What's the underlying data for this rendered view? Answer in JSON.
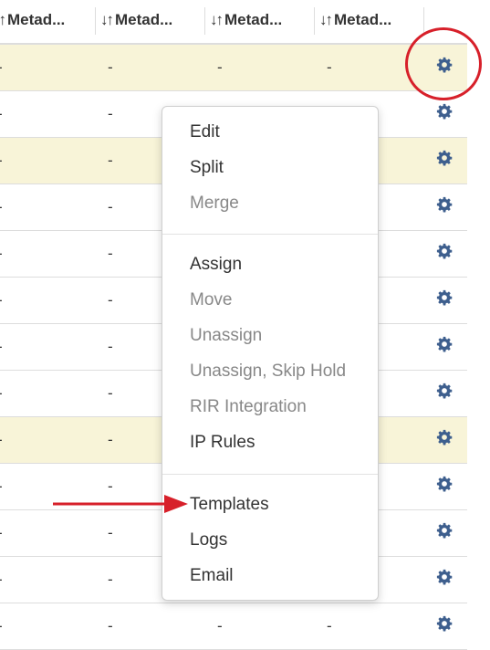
{
  "table": {
    "columns": [
      {
        "sort_icon": "↓↑",
        "label": "Metad..."
      },
      {
        "sort_icon": "↓↑",
        "label": "Metad..."
      },
      {
        "sort_icon": "↓↑",
        "label": "Metad..."
      },
      {
        "sort_icon": "↓↑",
        "label": "Metad..."
      }
    ],
    "rows": [
      {
        "highlight": true,
        "cells": [
          "-",
          "-",
          "-",
          "-"
        ],
        "action_icon": "gear-icon"
      },
      {
        "highlight": false,
        "cells": [
          "-",
          "-",
          "",
          ""
        ],
        "action_icon": "gear-icon"
      },
      {
        "highlight": true,
        "cells": [
          "-",
          "-",
          "",
          ""
        ],
        "action_icon": "gear-icon"
      },
      {
        "highlight": false,
        "cells": [
          "-",
          "-",
          "",
          ""
        ],
        "action_icon": "gear-icon"
      },
      {
        "highlight": false,
        "cells": [
          "-",
          "-",
          "",
          ""
        ],
        "action_icon": "gear-icon"
      },
      {
        "highlight": false,
        "cells": [
          "-",
          "-",
          "",
          ""
        ],
        "action_icon": "gear-icon"
      },
      {
        "highlight": false,
        "cells": [
          "-",
          "-",
          "",
          ""
        ],
        "action_icon": "gear-icon"
      },
      {
        "highlight": false,
        "cells": [
          "-",
          "-",
          "",
          ""
        ],
        "action_icon": "gear-icon"
      },
      {
        "highlight": true,
        "cells": [
          "-",
          "-",
          "",
          ""
        ],
        "action_icon": "gear-icon"
      },
      {
        "highlight": false,
        "cells": [
          "-",
          "-",
          "",
          ""
        ],
        "action_icon": "gear-icon"
      },
      {
        "highlight": false,
        "cells": [
          "-",
          "-",
          "",
          ""
        ],
        "action_icon": "gear-icon"
      },
      {
        "highlight": false,
        "cells": [
          "-",
          "-",
          "",
          ""
        ],
        "action_icon": "gear-icon"
      },
      {
        "highlight": false,
        "cells": [
          "-",
          "-",
          "-",
          "-"
        ],
        "action_icon": "gear-icon"
      }
    ]
  },
  "context_menu": {
    "groups": [
      [
        {
          "label": "Edit",
          "enabled": true
        },
        {
          "label": "Split",
          "enabled": true
        },
        {
          "label": "Merge",
          "enabled": false
        }
      ],
      [
        {
          "label": "Assign",
          "enabled": true
        },
        {
          "label": "Move",
          "enabled": false
        },
        {
          "label": "Unassign",
          "enabled": false
        },
        {
          "label": "Unassign, Skip Hold",
          "enabled": false
        },
        {
          "label": "RIR Integration",
          "enabled": false
        },
        {
          "label": "IP Rules",
          "enabled": true
        }
      ],
      [
        {
          "label": "Templates",
          "enabled": true
        },
        {
          "label": "Logs",
          "enabled": true
        },
        {
          "label": "Email",
          "enabled": true
        }
      ]
    ]
  },
  "colors": {
    "row_highlight": "#f8f4d8",
    "gear_icon": "#3e5f8e",
    "annotation_red": "#d7202a",
    "menu_item_enabled": "#333333",
    "menu_item_disabled": "#888888"
  }
}
